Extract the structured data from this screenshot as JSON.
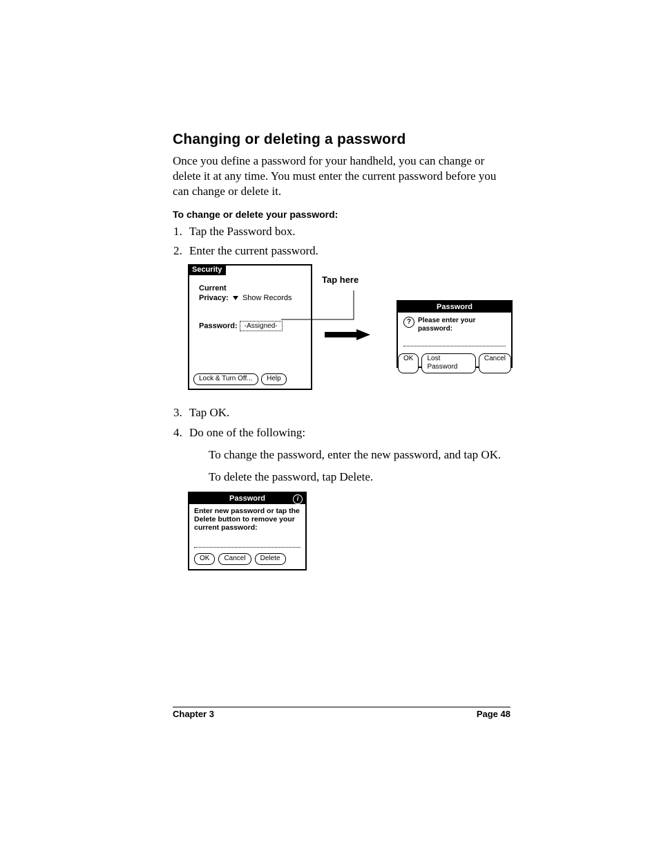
{
  "heading": "Changing or deleting a password",
  "intro": "Once you define a password for your handheld, you can change or delete it at any time. You must enter the current password before you can change or delete it.",
  "procedure_heading": "To change or delete your password:",
  "steps_part1": [
    "Tap the Password box.",
    "Enter the current password."
  ],
  "steps_part2": [
    "Tap OK.",
    "Do one of the following:"
  ],
  "substeps": [
    "To change the password, enter the new password, and tap OK.",
    "To delete the password, tap Delete."
  ],
  "figure1": {
    "callout": "Tap here",
    "security_screen": {
      "title": "Security",
      "line1a": "Current",
      "line1b_label": "Privacy:",
      "line1b_value": "Show Records",
      "password_label": "Password:",
      "password_value": "-Assigned-",
      "lock_btn": "Lock & Turn Off...",
      "help_btn": "Help"
    },
    "password_dialog": {
      "title": "Password",
      "prompt": "Please enter your password:",
      "ok": "OK",
      "lost": "Lost Password",
      "cancel": "Cancel"
    }
  },
  "figure2": {
    "title": "Password",
    "prompt": "Enter new password or tap the Delete button to remove your current password:",
    "ok": "OK",
    "cancel": "Cancel",
    "delete": "Delete"
  },
  "footer": {
    "left": "Chapter 3",
    "right": "Page 48"
  }
}
